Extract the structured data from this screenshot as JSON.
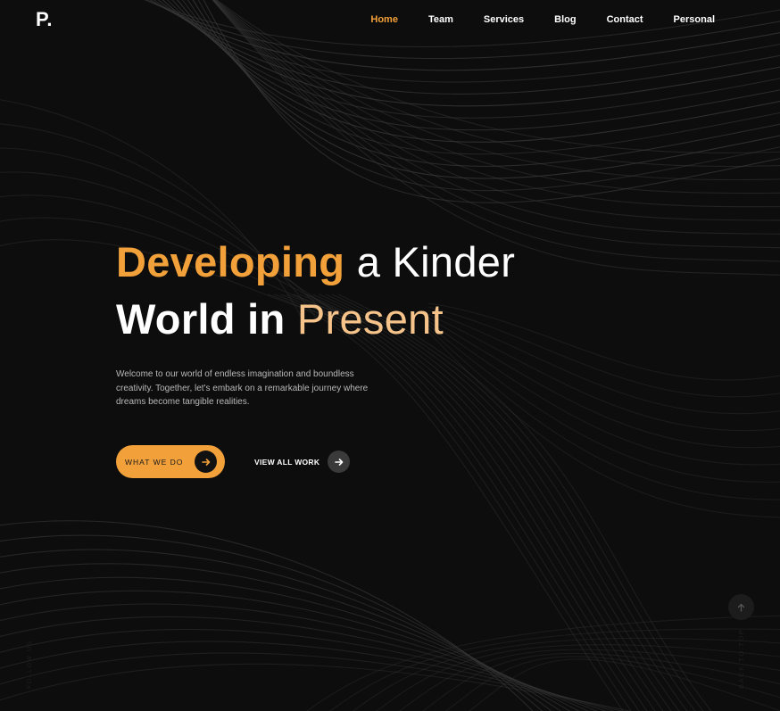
{
  "brand": {
    "logo": "P."
  },
  "nav": {
    "items": [
      {
        "label": "Home",
        "active": true
      },
      {
        "label": "Team"
      },
      {
        "label": "Services"
      },
      {
        "label": "Blog"
      },
      {
        "label": "Contact"
      },
      {
        "label": "Personal"
      }
    ]
  },
  "hero": {
    "line1_highlight": "Developing",
    "line1_rest": "a Kinder",
    "line2_bold": "World in",
    "line2_highlight": "Present",
    "intro": "Welcome to our world of endless imagination and boundless creativity. Together, let's embark on a remarkable journey where dreams become tangible realities."
  },
  "actions": {
    "primary_label": "WHAT WE DO",
    "secondary_label": "VIEW ALL WORK",
    "arrow_icon": "arrow-right-icon"
  },
  "side": {
    "left_label": "FOLLOW US",
    "back_to_top": "BACK TO TOP",
    "up_icon": "arrow-up-icon"
  },
  "colors": {
    "background": "#0d0d0d",
    "accent": "#f2a03a",
    "accent_light": "#f6c48a",
    "text": "#ffffff",
    "muted_text": "#b8b8b8",
    "line": "#3a3a3a"
  }
}
